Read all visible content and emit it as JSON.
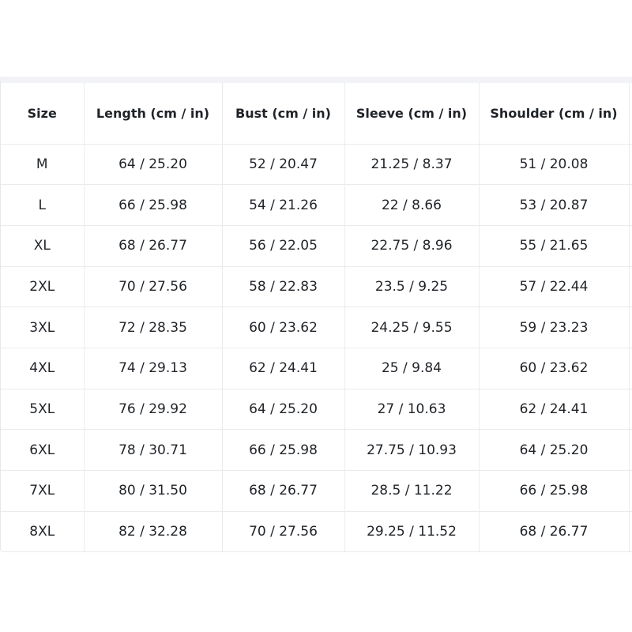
{
  "table": {
    "headers": [
      "Size",
      "Length (cm / in)",
      "Bust (cm / in)",
      "Sleeve (cm / in)",
      "Shoulder (cm / in)",
      ""
    ],
    "rows": [
      [
        "M",
        "64 / 25.20",
        "52 / 20.47",
        "21.25 / 8.37",
        "51 / 20.08"
      ],
      [
        "L",
        "66 / 25.98",
        "54 / 21.26",
        "22 / 8.66",
        "53 / 20.87"
      ],
      [
        "XL",
        "68 / 26.77",
        "56 / 22.05",
        "22.75 / 8.96",
        "55 / 21.65"
      ],
      [
        "2XL",
        "70 / 27.56",
        "58 / 22.83",
        "23.5 / 9.25",
        "57 / 22.44"
      ],
      [
        "3XL",
        "72 / 28.35",
        "60 / 23.62",
        "24.25 / 9.55",
        "59 / 23.23"
      ],
      [
        "4XL",
        "74 / 29.13",
        "62 / 24.41",
        "25 / 9.84",
        "60 / 23.62"
      ],
      [
        "5XL",
        "76 / 29.92",
        "64 / 25.20",
        "27 / 10.63",
        "62 / 24.41"
      ],
      [
        "6XL",
        "78 / 30.71",
        "66 / 25.98",
        "27.75 / 10.93",
        "64 / 25.20"
      ],
      [
        "7XL",
        "80 / 31.50",
        "68 / 26.77",
        "28.5 / 11.22",
        "66 / 25.98"
      ],
      [
        "8XL",
        "82 / 32.28",
        "70 / 27.56",
        "29.25 / 11.52",
        "68 / 26.77"
      ]
    ]
  }
}
